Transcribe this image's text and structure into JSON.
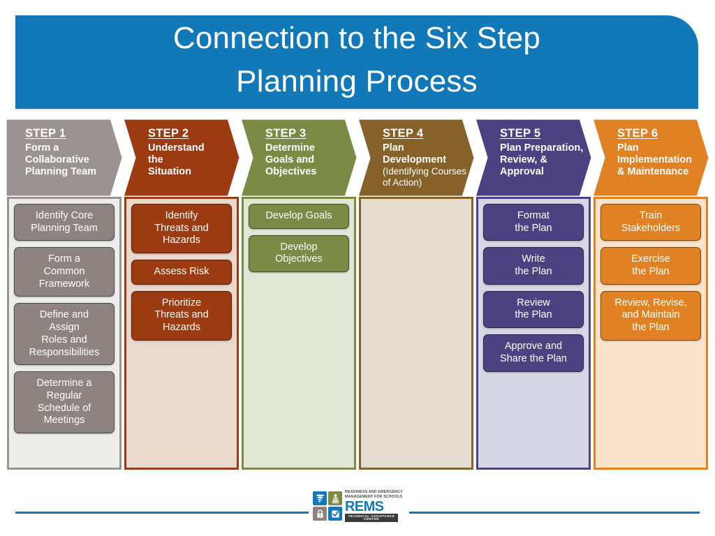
{
  "title": {
    "text": "Connection to the Six Step\nPlanning Process",
    "background": "#1179B8",
    "color": "#FFFFFF"
  },
  "steps": [
    {
      "number": "STEP 1",
      "title": "Form a\nCollaborative\nPlanning Team",
      "subtitle": "",
      "header_color": "#9A9391",
      "body_color": "#EDEDEB",
      "border_color": "#9A9391",
      "item_color": "#8D8481",
      "items": [
        "Identify Core\nPlanning Team",
        "Form a\nCommon\nFramework",
        "Define and\nAssign\nRoles and\nResponsibilities",
        "Determine a\nRegular\nSchedule of\nMeetings"
      ]
    },
    {
      "number": "STEP 2",
      "title": "Understand\nthe\nSituation",
      "subtitle": "",
      "header_color": "#9C3A12",
      "body_color": "#EBD9CD",
      "border_color": "#9C3A12",
      "item_color": "#9C3A12",
      "items": [
        "Identify\nThreats and\nHazards",
        "Assess Risk",
        "Prioritize\nThreats and\nHazards"
      ]
    },
    {
      "number": "STEP 3",
      "title": "Determine\nGoals and\nObjectives",
      "subtitle": "",
      "header_color": "#7B8A44",
      "body_color": "#E3E7D8",
      "border_color": "#7B8A44",
      "item_color": "#7B8A44",
      "items": [
        "Develop Goals",
        "Develop\nObjectives"
      ]
    },
    {
      "number": "STEP 4",
      "title": "Plan Development",
      "subtitle": "(Identifying Courses\nof Action)",
      "header_color": "#87612A",
      "body_color": "#E5DDD2",
      "border_color": "#87612A",
      "item_color": "#87612A",
      "items": []
    },
    {
      "number": "STEP 5",
      "title": "Plan Preparation,\nReview, &\nApproval",
      "subtitle": "",
      "header_color": "#4C4281",
      "body_color": "#D6D6E4",
      "border_color": "#4C4281",
      "item_color": "#4C4281",
      "items": [
        "Format\nthe Plan",
        "Write\nthe Plan",
        "Review\nthe Plan",
        "Approve and\nShare the Plan"
      ]
    },
    {
      "number": "STEP 6",
      "title": "Plan\nImplementation\n& Maintenance",
      "subtitle": "",
      "header_color": "#E08124",
      "body_color": "#FAE3CB",
      "border_color": "#E08124",
      "item_color": "#E08124",
      "items": [
        "Train\nStakeholders",
        "Exercise\nthe Plan",
        "Review, Revise,\nand Maintain\nthe Plan"
      ]
    }
  ],
  "footer": {
    "rule_color": "#1179B8",
    "logo": {
      "tagline": "READINESS AND EMERGENCY\nMANAGEMENT FOR SCHOOLS",
      "name": "REMS",
      "band": "TECHNICAL ASSISTANCE CENTER",
      "tiles": [
        {
          "icon": "tornado-icon",
          "color": "#1179B8"
        },
        {
          "icon": "first-aid-icon",
          "color": "#7B8A44"
        },
        {
          "icon": "padlock-icon",
          "color": "#8D8481"
        },
        {
          "icon": "checkbox-icon",
          "color": "#1179B8"
        }
      ]
    }
  }
}
